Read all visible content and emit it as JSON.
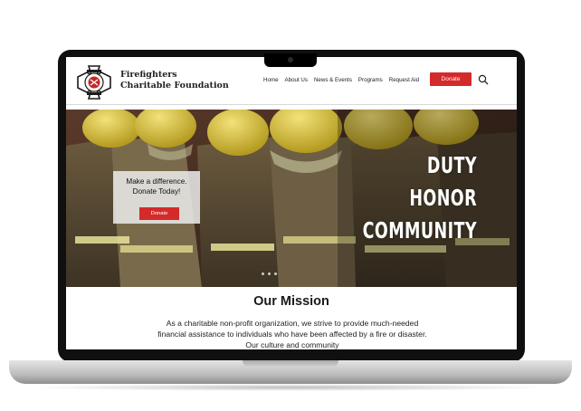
{
  "site": {
    "org_name": "Firefighters Charitable Foundation",
    "nav": [
      "Home",
      "About Us",
      "News & Events",
      "Programs",
      "Request Aid"
    ],
    "donate_label": "Donate",
    "brand_red": "#d42a2a"
  },
  "hero": {
    "cta_line1": "Make a difference.",
    "cta_line2": "Donate Today!",
    "cta_button": "Donate",
    "motto": [
      "DUTY",
      "HONOR",
      "COMMUNITY"
    ],
    "slide_count": 3
  },
  "mission": {
    "title": "Our Mission",
    "body": "As a charitable non-profit organization, we strive to provide much-needed financial assistance to individuals who have been affected by a fire or disaster. Our culture and community"
  },
  "icons": [
    "maltese-cross-logo-icon",
    "search-icon"
  ]
}
